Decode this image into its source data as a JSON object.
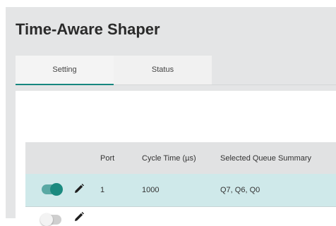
{
  "page": {
    "title": "Time-Aware Shaper"
  },
  "tabs": [
    {
      "label": "Setting",
      "active": true
    },
    {
      "label": "Status",
      "active": false
    }
  ],
  "table": {
    "headers": {
      "port": "Port",
      "cycle_time": "Cycle Time (µs)",
      "queue_summary": "Selected Queue Summary"
    },
    "rows": [
      {
        "enabled": true,
        "port": "1",
        "cycle_time": "1000",
        "queue_summary": "Q7, Q6, Q0"
      },
      {
        "enabled": false,
        "port": "",
        "cycle_time": "",
        "queue_summary": ""
      }
    ]
  },
  "colors": {
    "accent": "#16877f",
    "toggle_on": "#1b8a7f",
    "row_highlight": "#cfe9ea",
    "header_bg": "#e1e2e3",
    "app_bg": "#e4e5e6"
  },
  "icons": {
    "edit": "pencil-icon"
  }
}
